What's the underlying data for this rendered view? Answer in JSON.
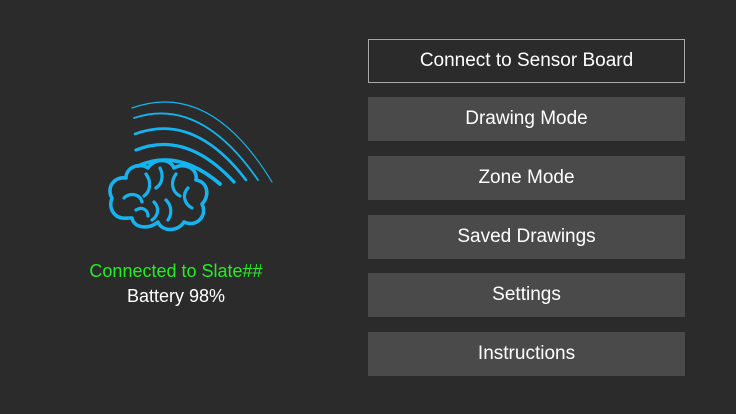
{
  "status": {
    "connection": "Connected to Slate##",
    "battery": "Battery 98%"
  },
  "logo": {
    "icon": "brain-signal-icon",
    "color": "#14b4f0"
  },
  "menu": {
    "connect": "Connect to Sensor Board",
    "drawing_mode": "Drawing Mode",
    "zone_mode": "Zone Mode",
    "saved_drawings": "Saved Drawings",
    "settings": "Settings",
    "instructions": "Instructions"
  },
  "colors": {
    "background": "#2b2b2b",
    "button": "#4a4a4a",
    "connected_text": "#22ee22",
    "text": "#ffffff"
  }
}
